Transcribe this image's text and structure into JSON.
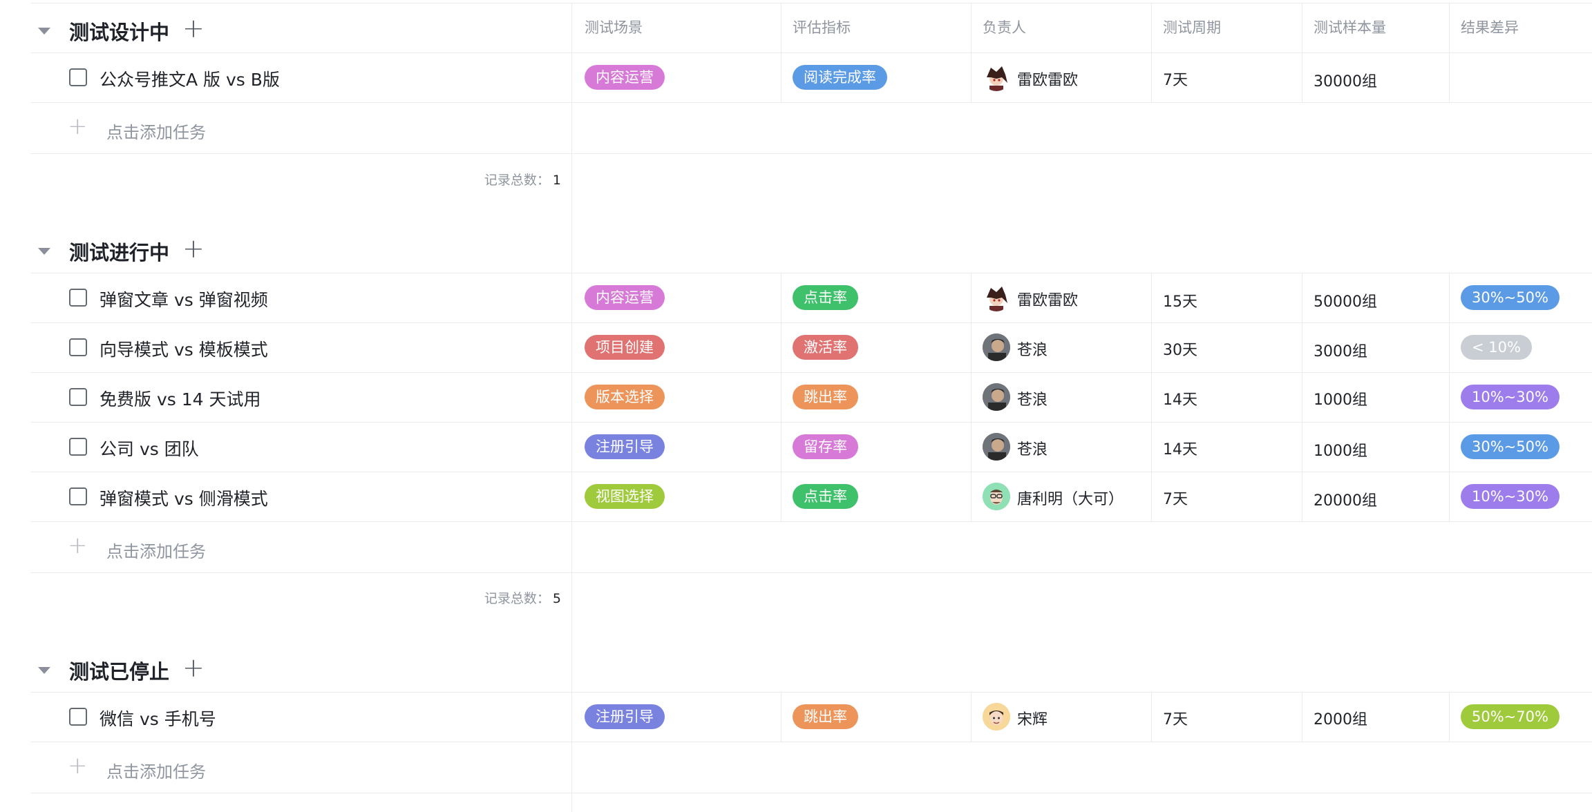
{
  "columns": {
    "scene": "测试场景",
    "metric": "评估指标",
    "owner": "负责人",
    "period": "测试周期",
    "sample": "测试样本量",
    "diff": "结果差异"
  },
  "add_task_label": "点击添加任务",
  "count_label": "记录总数：",
  "colors": {
    "pink": "#d779d7",
    "blue": "#5b9be6",
    "green": "#3ec16a",
    "red": "#e07372",
    "orange": "#ec945a",
    "indigo": "#7a82e0",
    "lime": "#9fca3c",
    "purple": "#9d7cec",
    "gray": "#c9cdd4"
  },
  "groups": [
    {
      "title": "测试设计中",
      "count": "1",
      "rows": [
        {
          "title": "公众号推文A 版 vs B版",
          "scene": "内容运营",
          "metric": "阅读完成率",
          "owner": "雷欧雷欧",
          "period": "7天",
          "sample": "30000组",
          "diff": ""
        }
      ]
    },
    {
      "title": "测试进行中",
      "count": "5",
      "rows": [
        {
          "title": "弹窗文章 vs 弹窗视频",
          "scene": "内容运营",
          "metric": "点击率",
          "owner": "雷欧雷欧",
          "period": "15天",
          "sample": "50000组",
          "diff": "30%~50%"
        },
        {
          "title": "向导模式 vs 模板模式",
          "scene": "项目创建",
          "metric": "激活率",
          "owner": "苍浪",
          "period": "30天",
          "sample": "3000组",
          "diff": "< 10%"
        },
        {
          "title": "免费版 vs 14 天试用",
          "scene": "版本选择",
          "metric": "跳出率",
          "owner": "苍浪",
          "period": "14天",
          "sample": "1000组",
          "diff": "10%~30%"
        },
        {
          "title": "公司 vs 团队",
          "scene": "注册引导",
          "metric": "留存率",
          "owner": "苍浪",
          "period": "14天",
          "sample": "1000组",
          "diff": "30%~50%"
        },
        {
          "title": "弹窗模式 vs 侧滑模式",
          "scene": "视图选择",
          "metric": "点击率",
          "owner": "唐利明（大可）",
          "period": "7天",
          "sample": "20000组",
          "diff": "10%~30%"
        }
      ]
    },
    {
      "title": "测试已停止",
      "count": "",
      "rows": [
        {
          "title": "微信 vs 手机号",
          "scene": "注册引导",
          "metric": "跳出率",
          "owner": "宋辉",
          "period": "7天",
          "sample": "2000组",
          "diff": "50%~70%"
        }
      ]
    }
  ]
}
